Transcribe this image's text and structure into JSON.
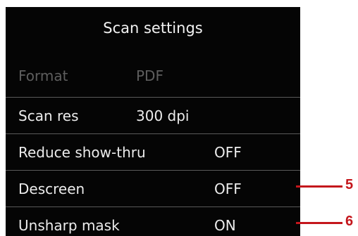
{
  "header": {
    "title": "Scan settings"
  },
  "rows": [
    {
      "label": "Format",
      "value": "PDF"
    },
    {
      "label": "Scan res",
      "value": "300 dpi"
    },
    {
      "label": "Reduce show-thru",
      "value": "OFF"
    },
    {
      "label": "Descreen",
      "value": "OFF"
    },
    {
      "label": "Unsharp mask",
      "value": "ON"
    }
  ],
  "callouts": [
    {
      "number": "5"
    },
    {
      "number": "6"
    }
  ],
  "colors": {
    "screen_bg": "#050505",
    "text": "#ececec",
    "dim_text": "#5e5e5e",
    "callout": "#c4161c"
  }
}
